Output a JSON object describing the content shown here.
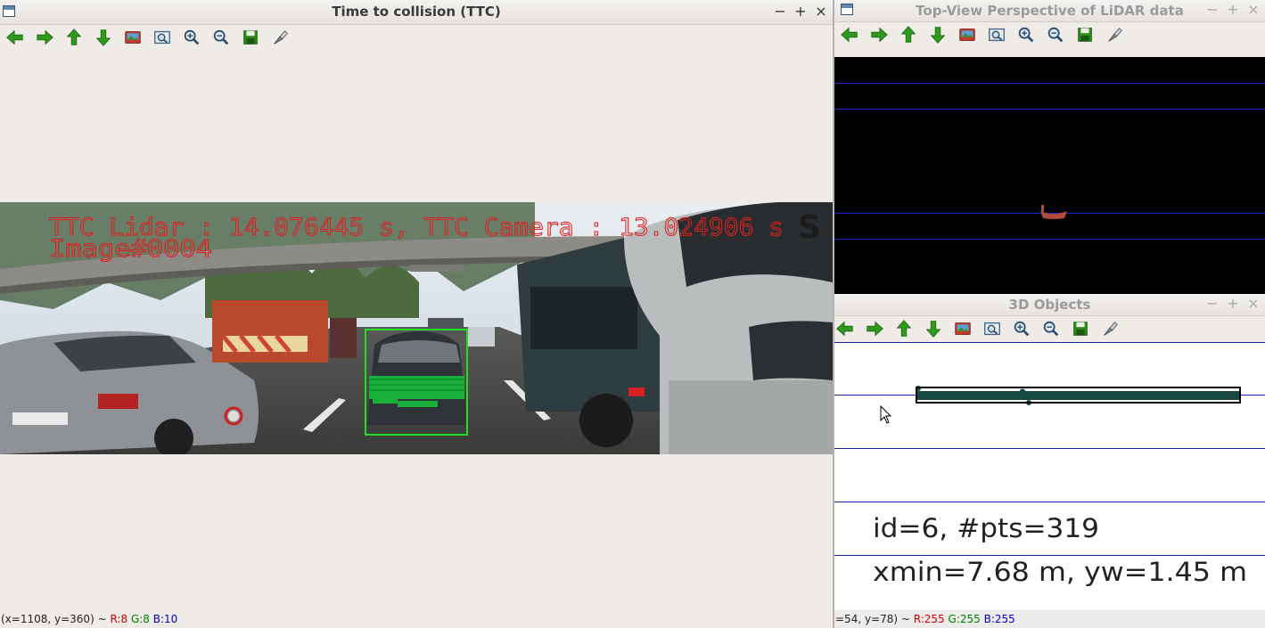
{
  "ttc_window": {
    "title": "Time to collision (TTC)",
    "overlay_line1": "TTC Lidar : 14.076445 s, TTC Camera : 13.024906 s",
    "overlay_line2": "Image#0004",
    "status_coords": "(x=1108, y=360) ~",
    "status_r": "R:8",
    "status_g": "G:8",
    "status_b": "B:10",
    "bbox_color": "#22dd22",
    "lidar_points_color": "#19b03a"
  },
  "topview_window": {
    "title": "Top-View Perspective of LiDAR data",
    "grid_line_color": "#1f23c8",
    "points_color": "#b04a3a"
  },
  "objects_window": {
    "title": "3D Objects",
    "text_line1": "id=6, #pts=319",
    "text_line2": "xmin=7.68 m, yw=1.45 m",
    "status_coords": "=54, y=78) ~",
    "status_r": "R:255",
    "status_g": "G:255",
    "status_b": "B:255",
    "grid_line_color": "#1f23a0",
    "points_color": "#174a45"
  },
  "toolbar_icons": [
    "arrow-left-icon",
    "arrow-right-icon",
    "arrow-up-icon",
    "arrow-down-icon",
    "image-icon",
    "zoom-fit-icon",
    "zoom-in-icon",
    "zoom-out-icon",
    "save-icon",
    "properties-icon"
  ],
  "window_buttons": {
    "minimize": "−",
    "maximize": "+",
    "close": "×"
  }
}
